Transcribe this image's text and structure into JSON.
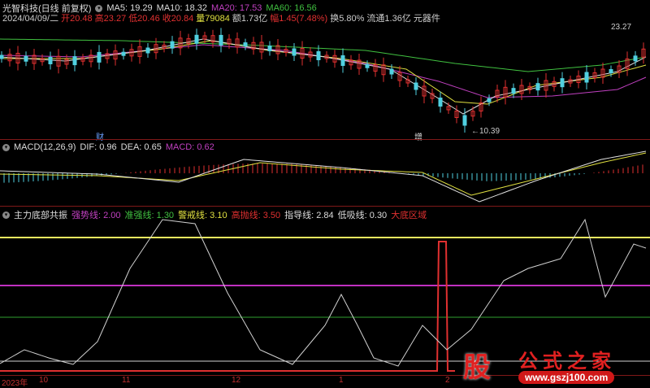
{
  "header": {
    "title": "光智科技(日线 前复权)",
    "ma5": "MA5: 19.29",
    "ma10": "MA10: 18.32",
    "ma20": "MA20: 17.53",
    "ma60": "MA60: 16.56",
    "date": "2024/04/09/二",
    "open": "开20.48",
    "high": "高23.27",
    "low": "低20.46",
    "close": "收20.84",
    "volume": "量79084",
    "amount": "额1.73亿",
    "change": "幅1.45(7.48%)",
    "turnover": "换5.80%",
    "float": "流通1.36亿",
    "sector": "元器件"
  },
  "price": {
    "high_label": "23.27",
    "low_label": "←10.39",
    "marker1": "财",
    "marker2": "增"
  },
  "macd": {
    "title": "MACD(12,26,9)",
    "dif": "DIF: 0.96",
    "dea": "DEA: 0.65",
    "macd": "MACD: 0.62"
  },
  "indicator": {
    "title": "主力底部共振",
    "strong": "强势线: 2.00",
    "quasi": "准强线: 1.30",
    "warn": "警戒线: 3.10",
    "high": "高抛线: 3.50",
    "guide": "指导线: 2.84",
    "low": "低吸线: 0.30",
    "bottom": "大底区域"
  },
  "axis": {
    "labels": [
      "2023年",
      "10",
      "11",
      "12",
      "1",
      "2"
    ]
  },
  "watermark": {
    "logo_char": "股",
    "name": "公式之家",
    "url": "www.gszj100.com"
  }
}
